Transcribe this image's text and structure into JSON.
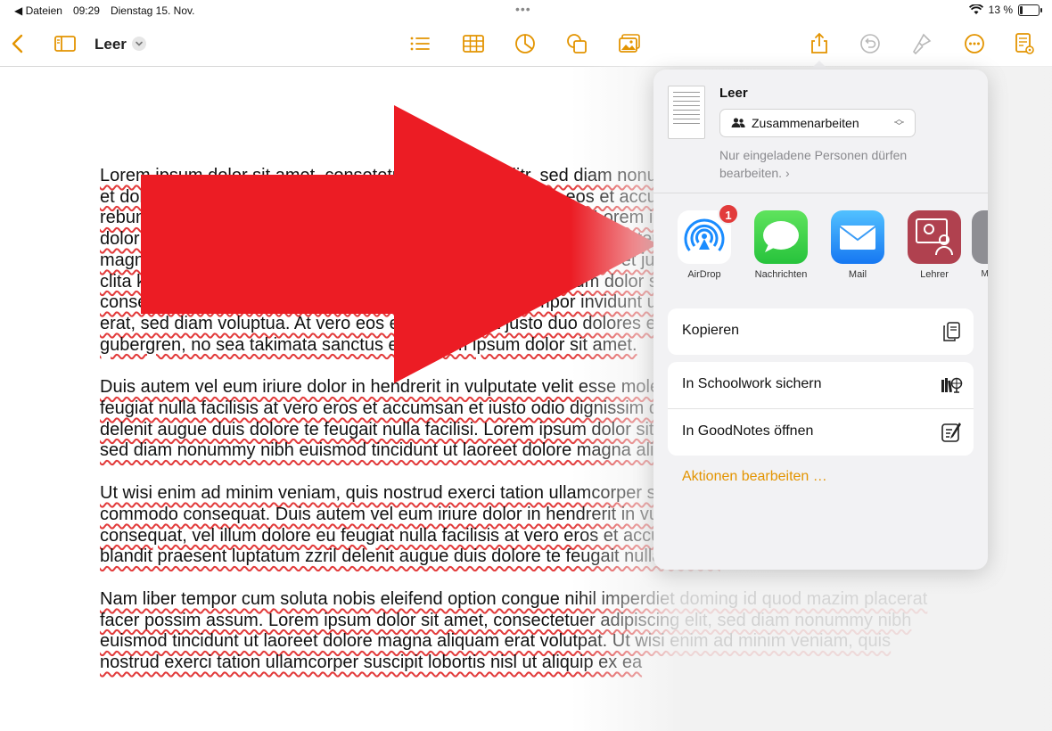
{
  "statusbar": {
    "back_app": "Dateien",
    "time": "09:29",
    "date": "Dienstag 15. Nov.",
    "battery_percent": "13 %",
    "battery_level": 0.13,
    "dots": "•••"
  },
  "toolbar": {
    "title": "Leer",
    "icons": [
      "back-chevron-icon",
      "sidebar-icon",
      "list-icon",
      "table-icon",
      "chart-icon",
      "shapes-icon",
      "media-icon",
      "share-icon",
      "undo-icon",
      "format-brush-icon",
      "more-icon",
      "document-view-icon"
    ]
  },
  "document": {
    "paragraphs": [
      "Lorem ipsum dolor sit amet, consetetur sadipscing elitr, sed diam nonumy eirmod tempor invidunt ut labore et dolore magna aliquyam erat, sed diam voluptua. At vero eos et accusam et justo duo dolores et ea rebum. Stet clita kasd gubergren, no sea takimata sanctus est Lorem ipsum dolor sit amet. Lorem ipsum dolor sit amet, consetetur sadipscing elitr, sed diam nonumy eirmod tempor invidunt ut labore et dolore magna aliquyam erat, sed diam voluptua. At vero eos et accusam et justo duo dolores et ea rebum. Stet clita kasd gubergren, no sea takimata sanctus est Lorem ipsum dolor sit amet. Lorem ipsum dolor sit amet, consetetur sadipscing elitr, sed diam nonumy eirmod tempor invidunt ut labore et dolore magna aliquyam erat, sed diam voluptua. At vero eos et accusam et justo duo dolores et ea rebum. Stet clita kasd gubergren, no sea takimata sanctus est Lorem ipsum dolor sit amet.",
      "Duis autem vel eum iriure dolor in hendrerit in vulputate velit esse molestie consequat, vel illum dolore eu feugiat nulla facilisis at vero eros et accumsan et iusto odio dignissim qui blandit praesent luptatum zzril delenit augue duis dolore te feugait nulla facilisi. Lorem ipsum dolor sit amet, consectetuer adipiscing elit, sed diam nonummy nibh euismod tincidunt ut laoreet dolore magna aliquam erat volutpat.",
      "Ut wisi enim ad minim veniam, quis nostrud exerci tation ullamcorper suscipit lobortis nisl ut aliquip ex ea commodo consequat. Duis autem vel eum iriure dolor in hendrerit in vulputate velit esse molestie consequat, vel illum dolore eu feugiat nulla facilisis at vero eros et accumsan et iusto odio dignissim qui blandit praesent luptatum zzril delenit augue duis dolore te feugait nulla facilisi.",
      "Nam liber tempor cum soluta nobis eleifend option congue nihil imperdiet doming id quod mazim placerat facer possim assum. Lorem ipsum dolor sit amet, consectetuer adipiscing elit, sed diam nonummy nibh euismod tincidunt ut laoreet dolore magna aliquam erat volutpat. Ut wisi enim ad minim veniam, quis nostrud exerci tation ullamcorper suscipit lobortis nisl ut aliquip ex ea"
    ]
  },
  "share_sheet": {
    "doc_name": "Leer",
    "collab_label": "Zusammenarbeiten",
    "collab_hint": "Nur eingeladene Personen dürfen bearbeiten.",
    "hint_chevron": "›",
    "apps": [
      {
        "label": "AirDrop",
        "badge": "1"
      },
      {
        "label": "Nachrichten"
      },
      {
        "label": "Mail"
      },
      {
        "label": "Lehrer"
      },
      {
        "label": "M… ei…"
      }
    ],
    "actions_1": [
      {
        "label": "Kopieren"
      }
    ],
    "actions_2": [
      {
        "label": "In Schoolwork sichern"
      },
      {
        "label": "In GoodNotes öffnen"
      }
    ],
    "edit_actions": "Aktionen bearbeiten …"
  },
  "colors": {
    "accent": "#e39400",
    "arrow": "#ec1c24",
    "spell_underline": "#e23b3b",
    "sheet_bg": "#f2f2f4"
  }
}
